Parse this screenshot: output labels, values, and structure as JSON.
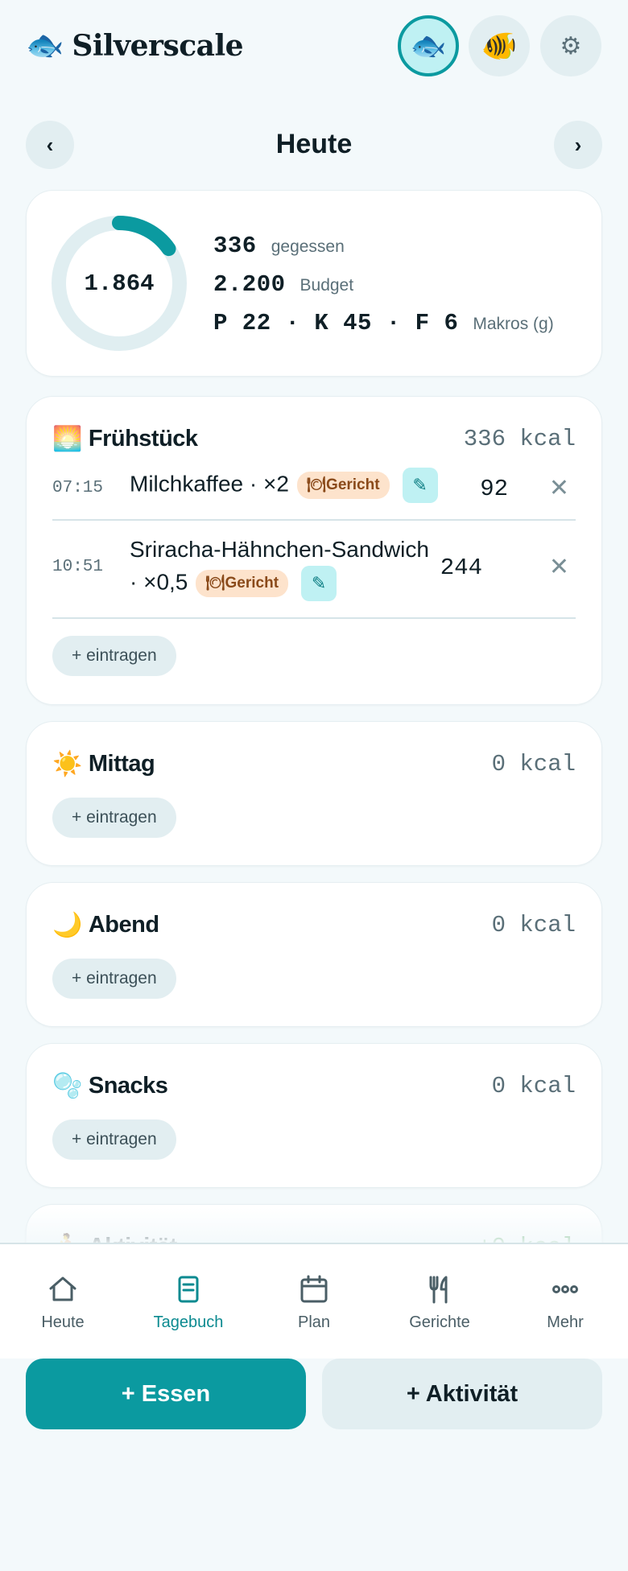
{
  "header": {
    "logo_icon": "fish-icon",
    "title": "Silverscale",
    "profile_buttons": [
      {
        "icon": "🐟",
        "icon_name": "fish-icon",
        "active": true
      },
      {
        "icon": "🐠",
        "icon_name": "tropical-fish-icon",
        "active": false
      }
    ],
    "settings_icon": "⚙"
  },
  "day_nav": {
    "prev": "‹",
    "title": "Heute",
    "next": "›"
  },
  "summary": {
    "remaining": "1.864",
    "progress_fraction": 0.153,
    "eaten_value": "336",
    "eaten_label": "gegessen",
    "budget_value": "2.200",
    "budget_label": "Budget",
    "macros_value": "P 22 · K 45 · F 6",
    "macros_label": "Makros (g)",
    "ring_color": "#0b9aa0",
    "ring_track_color": "#e0eef1"
  },
  "meals": {
    "breakfast": {
      "emoji": "🌅",
      "title": "Frühstück",
      "kcal": "336 kcal",
      "entries": [
        {
          "time": "07:15",
          "name": "Milchkaffee · ×2",
          "badge": "🍽Gericht",
          "kcal": "92",
          "edit": "✎",
          "delete": "✕"
        },
        {
          "time": "10:51",
          "name_line1": "Sriracha-Hähnchen-Sandwich",
          "name_line2": "· ×0,5",
          "badge": "🍽Gericht",
          "kcal": "244",
          "edit": "✎",
          "delete": "✕"
        }
      ],
      "add_label": "+ eintragen"
    },
    "lunch": {
      "emoji": "☀️",
      "title": "Mittag",
      "kcal": "0 kcal",
      "add_label": "+ eintragen"
    },
    "dinner": {
      "emoji": "🌙",
      "title": "Abend",
      "kcal": "0 kcal",
      "add_label": "+ eintragen"
    },
    "snacks": {
      "emoji": "🫧",
      "title": "Snacks",
      "kcal": "0 kcal",
      "add_label": "+ eintragen"
    },
    "activity": {
      "emoji": "🏃",
      "title": "Aktivität",
      "kcal": "+0 kcal"
    }
  },
  "bottom_nav": [
    {
      "label": "Heute",
      "icon": "home-icon",
      "active": false
    },
    {
      "label": "Tagebuch",
      "icon": "journal-icon",
      "active": true
    },
    {
      "label": "Plan",
      "icon": "calendar-icon",
      "active": false
    },
    {
      "label": "Gerichte",
      "icon": "fork-knife-icon",
      "active": false
    },
    {
      "label": "Mehr",
      "icon": "more-dots-icon",
      "active": false
    }
  ],
  "actions": {
    "add_food": "+ Essen",
    "add_activity": "+ Aktivität"
  },
  "colors": {
    "accent": "#0b9aa0",
    "accent_light": "#bff1f3",
    "badge_bg": "#fde3cc",
    "activity_green": "#3f9a4c"
  }
}
